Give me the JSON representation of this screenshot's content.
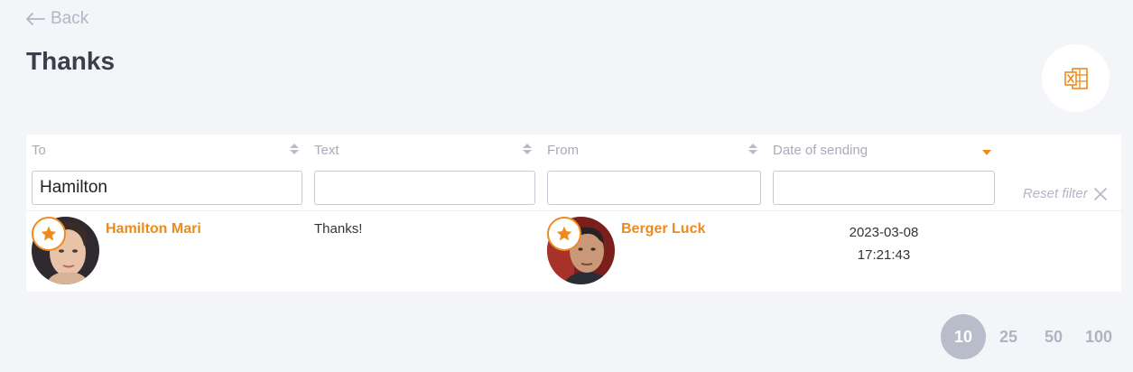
{
  "nav": {
    "back_label": "Back"
  },
  "page": {
    "title": "Thanks"
  },
  "toolbar": {
    "export_icon": "excel-export-icon"
  },
  "table": {
    "columns": [
      {
        "label": "To",
        "sort": "none"
      },
      {
        "label": "Text",
        "sort": "none"
      },
      {
        "label": "From",
        "sort": "none"
      },
      {
        "label": "Date of sending",
        "sort": "desc"
      }
    ],
    "filters": {
      "to": "Hamilton",
      "text": "",
      "from": "",
      "date": ""
    },
    "reset_label": "Reset filter",
    "rows": [
      {
        "to_name": "Hamilton Mari",
        "text": "Thanks!",
        "from_name": "Berger Luck",
        "date": "2023-03-08",
        "time": "17:21:43"
      }
    ]
  },
  "pagination": {
    "sizes": [
      "10",
      "25",
      "50",
      "100"
    ],
    "selected": "10"
  },
  "colors": {
    "accent": "#ee8a1a",
    "page_bg": "#f4f5f9",
    "muted": "#b3b6c3"
  }
}
